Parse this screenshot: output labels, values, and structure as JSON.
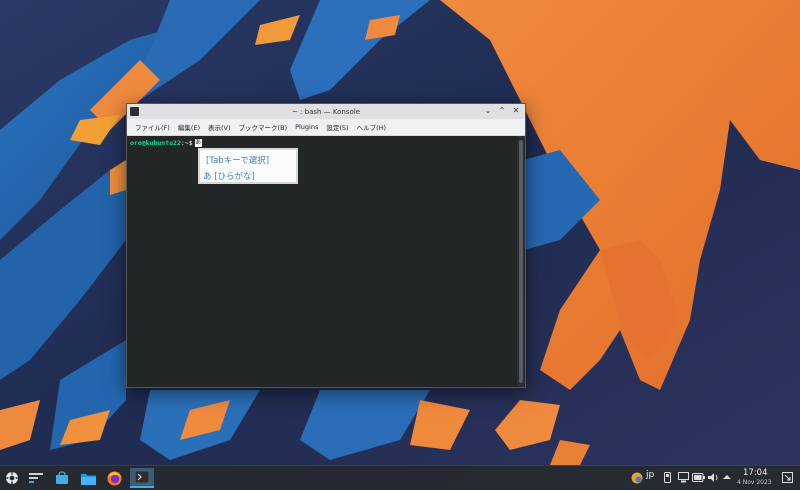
{
  "window": {
    "title": "~ : bash — Konsole",
    "menu": [
      "ファイル(F)",
      "編集(E)",
      "表示(V)",
      "ブックマーク(B)",
      "Plugins",
      "設定(S)",
      "ヘルプ(H)"
    ]
  },
  "terminal": {
    "prompt_user": "oro@kubuntu22",
    "prompt_symbol": ":~$",
    "input_char": "あ"
  },
  "ime": {
    "line1": "[Tabキーで選択]",
    "line2": "あ [ひらがな]"
  },
  "tray": {
    "input_method": "jp"
  },
  "clock": {
    "time": "17:04",
    "date": "4 Nov 2023"
  },
  "colors": {
    "prompt_green": "#1cdc9a",
    "ime_text": "#3d7fc0",
    "accent": "#3daee9"
  },
  "icons": [
    "app-launcher-icon",
    "desktop-pager-icon",
    "store-icon",
    "files-icon",
    "firefox-icon",
    "konsole-icon",
    "network-icon",
    "battery-icon",
    "volume-icon",
    "expand-tray-icon",
    "show-desktop-icon"
  ]
}
